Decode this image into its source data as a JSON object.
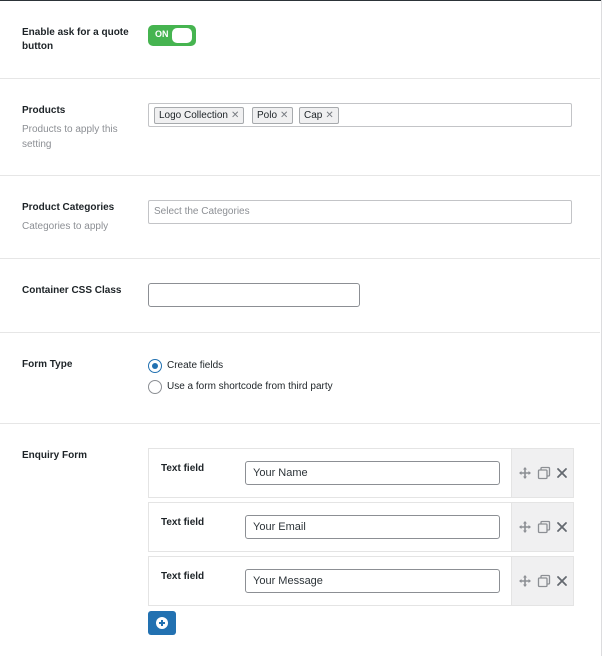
{
  "enable_quote": {
    "label": "Enable ask for a quote button",
    "toggle_text": "ON"
  },
  "products": {
    "label": "Products",
    "description": "Products to apply this setting",
    "tags": [
      "Logo Collection",
      "Polo",
      "Cap"
    ],
    "remove_glyph": "✕"
  },
  "categories": {
    "label": "Product Categories",
    "description": "Categories to apply",
    "placeholder": "Select the Categories"
  },
  "container_css": {
    "label": "Container CSS Class",
    "value": ""
  },
  "form_type": {
    "label": "Form Type",
    "options": [
      "Create fields",
      "Use a form shortcode from third party"
    ],
    "selected": "Create fields"
  },
  "enquiry_form": {
    "label": "Enquiry Form",
    "fields": [
      {
        "type_label": "Text field",
        "value": "Your Name"
      },
      {
        "type_label": "Text field",
        "value": "Your Email"
      },
      {
        "type_label": "Text field",
        "value": "Your Message"
      }
    ],
    "icons": [
      "move-icon",
      "duplicate-icon",
      "remove-icon"
    ]
  },
  "colors": {
    "toggle_on": "#46b450",
    "primary": "#2271b1"
  }
}
